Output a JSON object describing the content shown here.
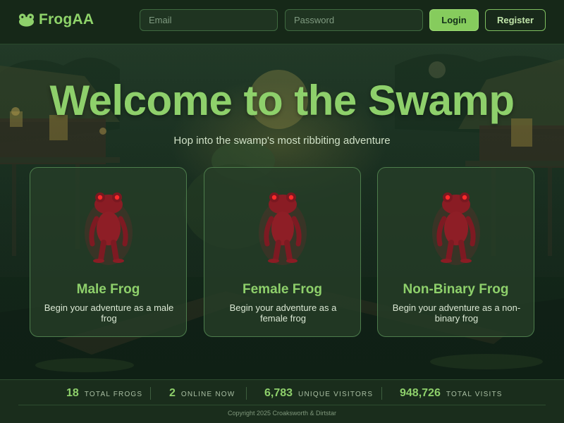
{
  "header": {
    "brand_name": "FrogAA",
    "brand_icon": "frog-face-icon",
    "email_placeholder": "Email",
    "password_placeholder": "Password",
    "login_label": "Login",
    "register_label": "Register"
  },
  "hero": {
    "title": "Welcome to the Swamp",
    "subtitle": "Hop into the swamp's most ribbiting adventure"
  },
  "cards": [
    {
      "title": "Male Frog",
      "description": "Begin your adventure as a male frog",
      "figure": "red-frog-figure"
    },
    {
      "title": "Female Frog",
      "description": "Begin your adventure as a female frog",
      "figure": "red-frog-figure"
    },
    {
      "title": "Non-Binary Frog",
      "description": "Begin your adventure as a non-binary frog",
      "figure": "red-frog-figure"
    }
  ],
  "stats": [
    {
      "value": "18",
      "label": "TOTAL FROGS"
    },
    {
      "value": "2",
      "label": "ONLINE NOW"
    },
    {
      "value": "6,783",
      "label": "UNIQUE VISITORS"
    },
    {
      "value": "948,726",
      "label": "TOTAL VISITS"
    }
  ],
  "footer": {
    "copyright": "Copyright 2025 Croaksworth & Dirtstar"
  },
  "colors": {
    "accent": "#8ed06b",
    "header_bg": "#162818",
    "card_border": "#4d7d4c",
    "frog_red": "#a3202a"
  }
}
